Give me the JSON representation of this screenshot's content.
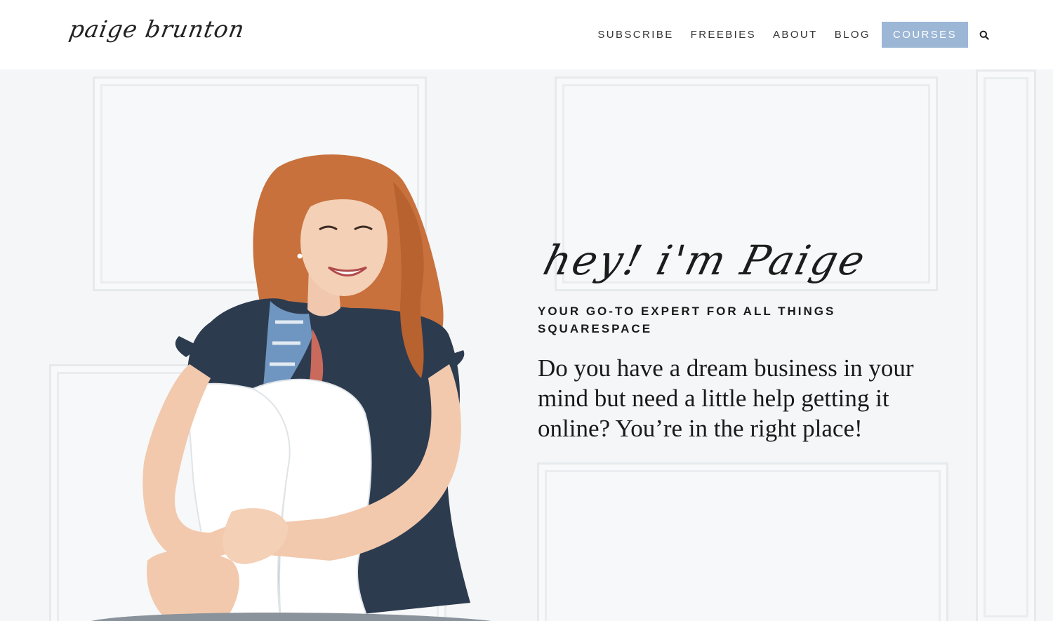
{
  "header": {
    "logo_text": "paige brunton",
    "nav": [
      {
        "label": "SUBSCRIBE"
      },
      {
        "label": "FREEBIES"
      },
      {
        "label": "ABOUT"
      },
      {
        "label": "BLOG"
      }
    ],
    "cta_label": "COURSES",
    "search_icon": "search-icon"
  },
  "hero": {
    "greeting": "hey! i'm Paige",
    "tagline": "YOUR GO-TO EXPERT FOR ALL THINGS SQUARESPACE",
    "intro": "Do you have a dream business in your mind but need a little help getting it online? You’re in the right place!"
  },
  "colors": {
    "accent": "#9cb6d6",
    "text": "#1a1a1a",
    "wall": "#f4f6f7",
    "hair": "#c8713d",
    "shirt": "#2d3b4f"
  }
}
